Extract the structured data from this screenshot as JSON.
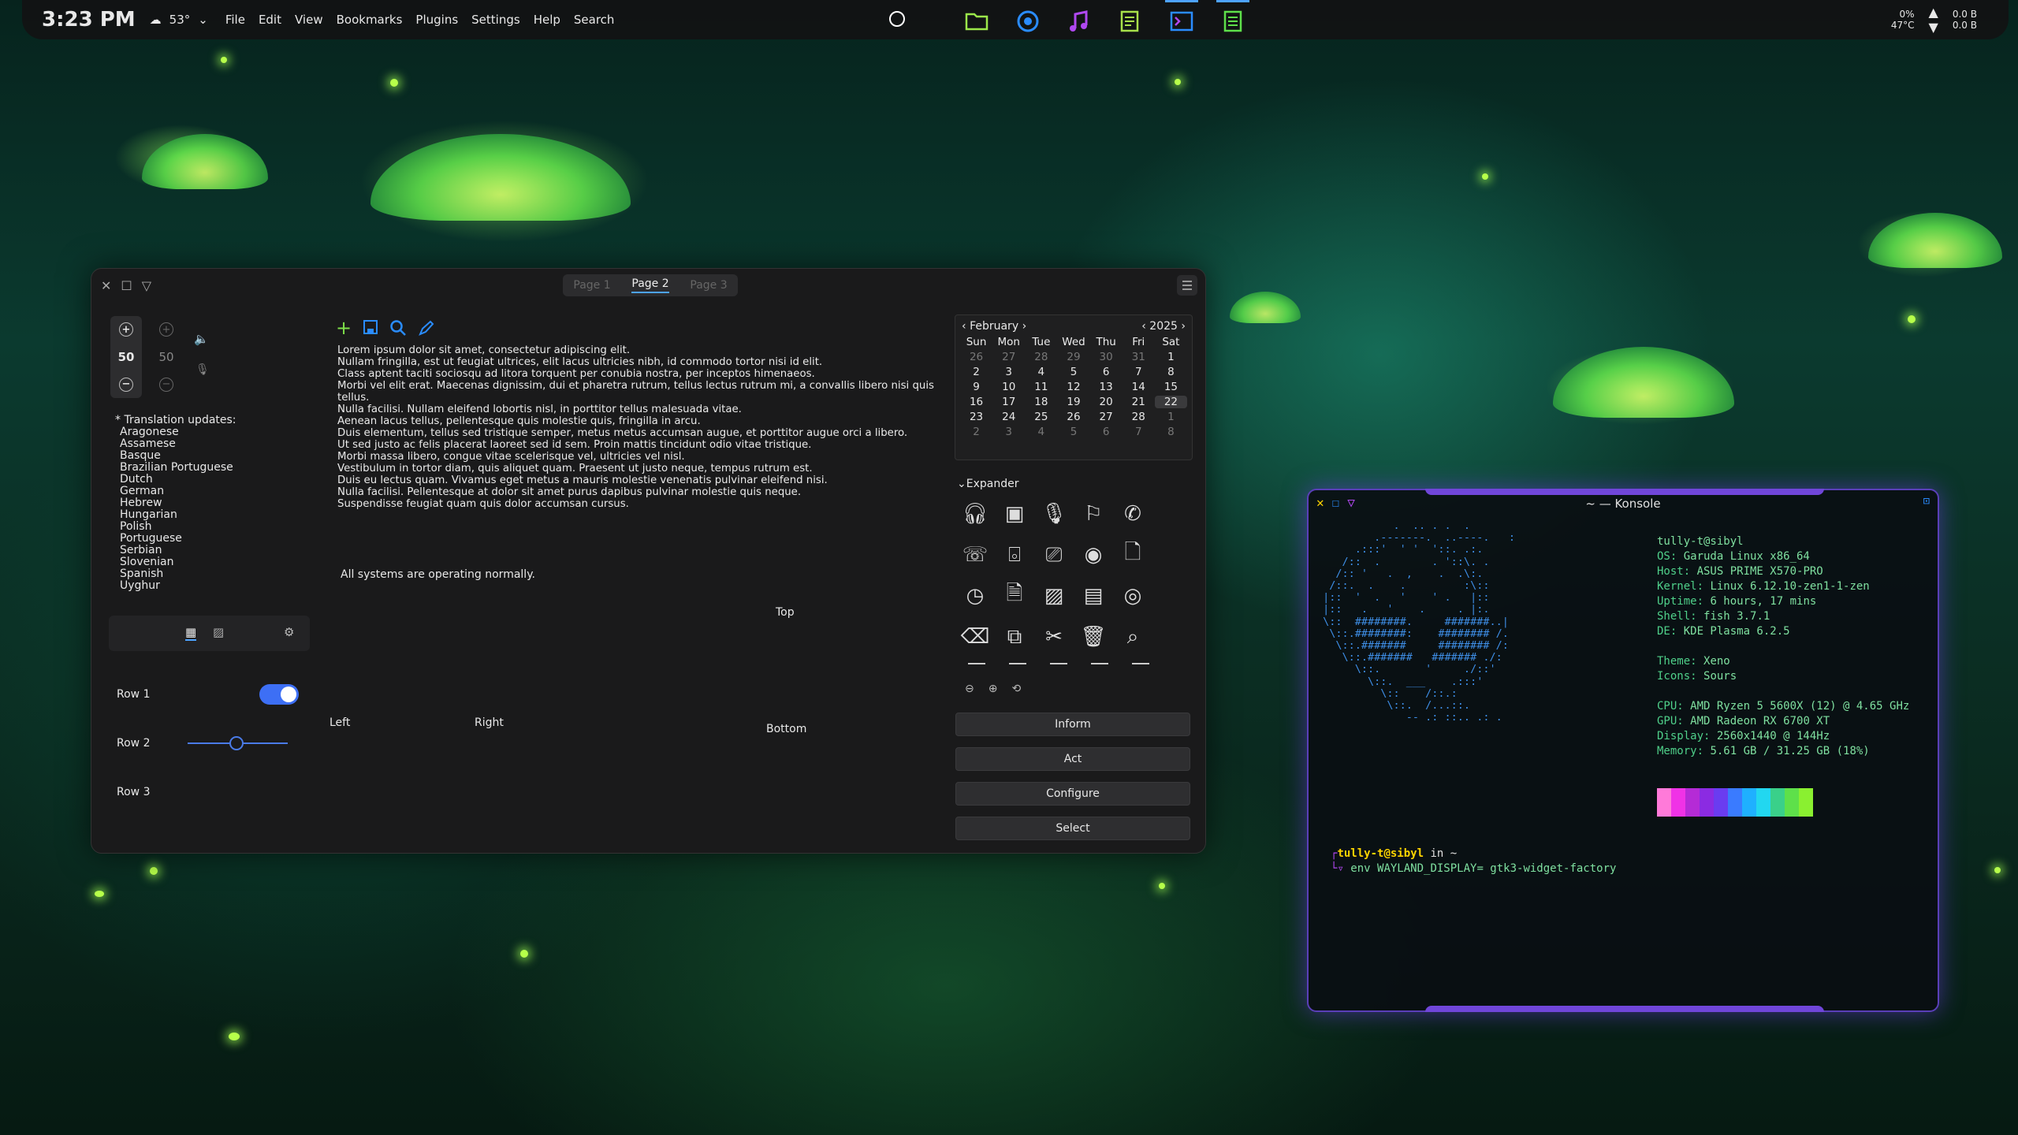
{
  "panel": {
    "clock": "3:23 PM",
    "temp": "53°",
    "menu": [
      "File",
      "Edit",
      "View",
      "Bookmarks",
      "Plugins",
      "Settings",
      "Help",
      "Search"
    ],
    "tray_percent": "0%",
    "tray_temp": "47°C",
    "net_up": "0.0 B",
    "net_down": "0.0 B"
  },
  "window": {
    "tabs": [
      "Page 1",
      "Page 2",
      "Page 3"
    ],
    "spin_value": "50",
    "spin_value2": "50",
    "translation_title": "* Translation updates:",
    "languages": [
      "Aragonese",
      "Assamese",
      "Basque",
      "Brazilian Portuguese",
      "Dutch",
      "German",
      "Hebrew",
      "Hungarian",
      "Polish",
      "Portuguese",
      "Serbian",
      "Slovenian",
      "Spanish",
      "Uyghur"
    ],
    "text_lines": [
      "Lorem ipsum dolor sit amet, consectetur adipiscing elit.",
      "Nullam fringilla, est ut feugiat ultrices, elit lacus ultricies nibh, id commodo tortor nisi id elit.",
      "Class aptent taciti sociosqu ad litora torquent per conubia nostra, per inceptos himenaeos.",
      "Morbi vel elit erat. Maecenas dignissim, dui et pharetra rutrum, tellus lectus rutrum mi, a convallis libero nisi quis tellus.",
      "Nulla facilisi. Nullam eleifend lobortis nisl, in porttitor tellus malesuada vitae.",
      "Aenean lacus tellus, pellentesque quis molestie quis, fringilla in arcu.",
      "Duis elementum, tellus sed tristique semper, metus metus accumsan augue, et porttitor augue orci a libero.",
      "Ut sed justo ac felis placerat laoreet sed id sem. Proin mattis tincidunt odio vitae tristique.",
      "Morbi massa libero, congue vitae scelerisque vel, ultricies vel nisl.",
      "Vestibulum in tortor diam, quis aliquet quam. Praesent ut justo neque, tempus rutrum est.",
      "Duis eu lectus quam. Vivamus eget metus a mauris molestie venenatis pulvinar eleifend nisi.",
      "Nulla facilisi. Pellentesque at dolor sit amet purus dapibus pulvinar molestie quis neque.",
      "Suspendisse feugiat quam quis dolor accumsan cursus."
    ],
    "status": "All systems are operating normally.",
    "pos_top": "Top",
    "pos_left": "Left",
    "pos_right": "Right",
    "pos_bottom": "Bottom",
    "row1": "Row 1",
    "row2": "Row 2",
    "row3": "Row 3",
    "switch_on": true,
    "slider_value": 0.4,
    "calendar": {
      "month": "February",
      "year": "2025",
      "day_headers": [
        "Sun",
        "Mon",
        "Tue",
        "Wed",
        "Thu",
        "Fri",
        "Sat"
      ],
      "days": [
        "26",
        "27",
        "28",
        "29",
        "30",
        "31",
        "1",
        "2",
        "3",
        "4",
        "5",
        "6",
        "7",
        "8",
        "9",
        "10",
        "11",
        "12",
        "13",
        "14",
        "15",
        "16",
        "17",
        "18",
        "19",
        "20",
        "21",
        "22",
        "23",
        "24",
        "25",
        "26",
        "27",
        "28",
        "1",
        "2",
        "3",
        "4",
        "5",
        "6",
        "7",
        "8"
      ],
      "selected": "22"
    },
    "expander": "Expander",
    "buttons": [
      "Inform",
      "Act",
      "Configure",
      "Select"
    ]
  },
  "konsole": {
    "title": "~ — Konsole",
    "user_host": "tully-t@sibyl",
    "info": [
      [
        "OS: ",
        "Garuda Linux x86_64"
      ],
      [
        "Host: ",
        "ASUS PRIME X570-PRO"
      ],
      [
        "Kernel: ",
        "Linux 6.12.10-zen1-1-zen"
      ],
      [
        "Uptime: ",
        "6 hours, 17 mins"
      ],
      [
        "Shell: ",
        "fish 3.7.1"
      ],
      [
        "DE: ",
        "KDE Plasma 6.2.5"
      ],
      [
        "",
        ""
      ],
      [
        "Theme: ",
        "Xeno"
      ],
      [
        "Icons: ",
        "Sours"
      ],
      [
        "",
        ""
      ],
      [
        "CPU: ",
        "AMD Ryzen 5 5600X (12) @ 4.65 GHz"
      ],
      [
        "GPU: ",
        "AMD Radeon RX 6700 XT"
      ],
      [
        "Display: ",
        "2560x1440 @ 144Hz"
      ],
      [
        "Memory: ",
        "5.61 GB / 31.25 GB (18%)"
      ]
    ],
    "palette": [
      "#ff7ad9",
      "#f032e6",
      "#b52bd6",
      "#8b2be2",
      "#6a3cf0",
      "#3a7bff",
      "#1fb0ff",
      "#22d7f0",
      "#3ad08a",
      "#5ee04a",
      "#8af030"
    ],
    "prompt_user": "tully-t@sibyl",
    "prompt_in": " in ~",
    "command": "env WAYLAND_DISPLAY= gtk3-widget-factory"
  },
  "colors": {
    "accent": "#4da3ff",
    "switch": "#3d6ff5",
    "konsole_border": "#5a3fb8"
  }
}
